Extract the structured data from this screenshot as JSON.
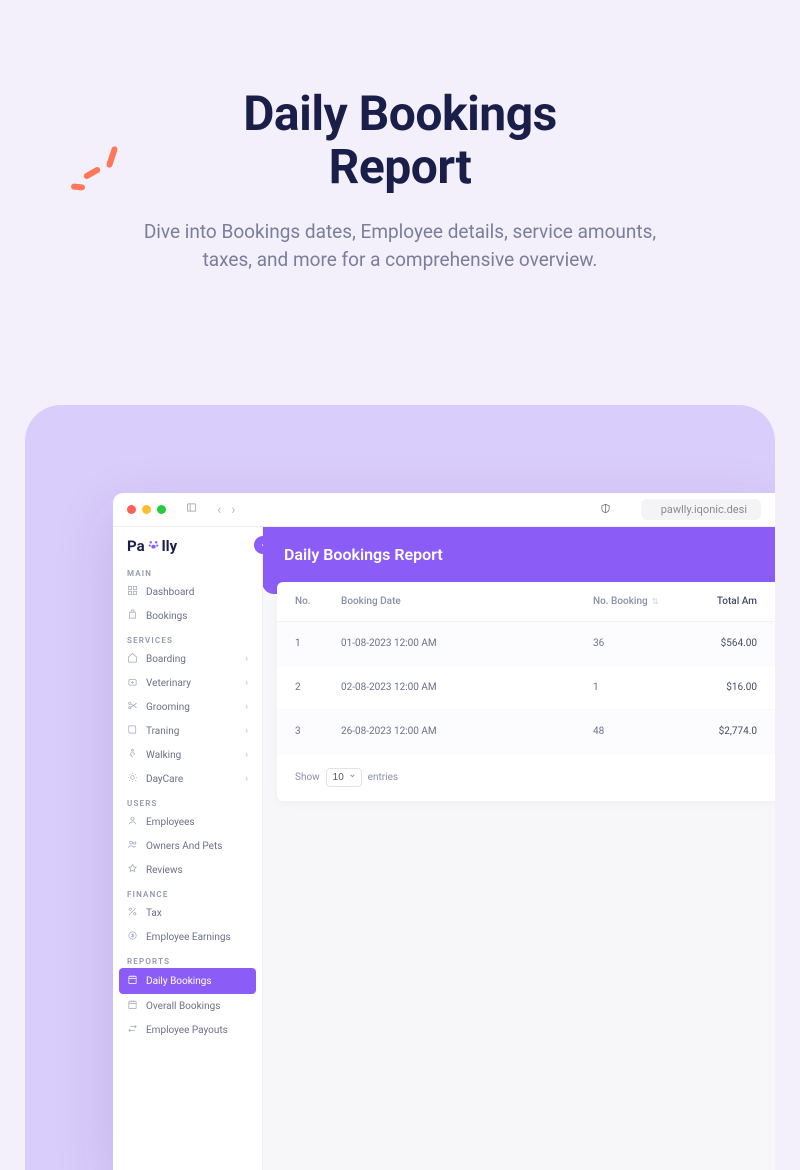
{
  "hero": {
    "title_line1": "Daily Bookings",
    "title_line2": "Report",
    "subtitle": "Dive into Bookings dates, Employee details, service amounts, taxes, and more for a comprehensive overview."
  },
  "browser": {
    "url": "pawlly.iqonic.desi"
  },
  "logo": {
    "pre": "Pa",
    "post": "lly"
  },
  "sidebar": {
    "groups": [
      {
        "label": "MAIN",
        "items": [
          {
            "icon": "grid",
            "label": "Dashboard",
            "hasChildren": false
          },
          {
            "icon": "bag",
            "label": "Bookings",
            "hasChildren": false
          }
        ]
      },
      {
        "label": "SERVICES",
        "items": [
          {
            "icon": "home",
            "label": "Boarding",
            "hasChildren": true
          },
          {
            "icon": "plus-med",
            "label": "Veterinary",
            "hasChildren": true
          },
          {
            "icon": "scissor",
            "label": "Grooming",
            "hasChildren": true
          },
          {
            "icon": "book",
            "label": "Traning",
            "hasChildren": true
          },
          {
            "icon": "walk",
            "label": "Walking",
            "hasChildren": true
          },
          {
            "icon": "sun",
            "label": "DayCare",
            "hasChildren": true
          }
        ]
      },
      {
        "label": "USERS",
        "items": [
          {
            "icon": "user",
            "label": "Employees",
            "hasChildren": false
          },
          {
            "icon": "users",
            "label": "Owners And Pets",
            "hasChildren": false
          },
          {
            "icon": "star",
            "label": "Reviews",
            "hasChildren": false
          }
        ]
      },
      {
        "label": "FINANCE",
        "items": [
          {
            "icon": "percent",
            "label": "Tax",
            "hasChildren": false
          },
          {
            "icon": "coin",
            "label": "Employee Earnings",
            "hasChildren": false
          }
        ]
      },
      {
        "label": "REPORTS",
        "items": [
          {
            "icon": "cal",
            "label": "Daily Bookings",
            "hasChildren": false,
            "active": true
          },
          {
            "icon": "cal",
            "label": "Overall Bookings",
            "hasChildren": false
          },
          {
            "icon": "switch",
            "label": "Employee Payouts",
            "hasChildren": false
          }
        ]
      }
    ]
  },
  "content": {
    "title": "Daily Bookings Report",
    "columns": {
      "no": "No.",
      "date": "Booking Date",
      "booking": "No. Booking",
      "amount": "Total Am"
    },
    "rows": [
      {
        "no": "1",
        "date": "01-08-2023 12:00 AM",
        "booking": "36",
        "amount": "$564.00"
      },
      {
        "no": "2",
        "date": "02-08-2023 12:00 AM",
        "booking": "1",
        "amount": "$16.00"
      },
      {
        "no": "3",
        "date": "26-08-2023 12:00 AM",
        "booking": "48",
        "amount": "$2,774.0"
      }
    ],
    "pager": {
      "show": "Show",
      "value": "10",
      "entries": "entries"
    }
  },
  "chart_data": {
    "type": "table",
    "title": "Daily Bookings Report",
    "columns": [
      "No.",
      "Booking Date",
      "No. Booking",
      "Total Amount"
    ],
    "rows": [
      [
        1,
        "01-08-2023 12:00 AM",
        36,
        564.0
      ],
      [
        2,
        "02-08-2023 12:00 AM",
        1,
        16.0
      ],
      [
        3,
        "26-08-2023 12:00 AM",
        48,
        2774.0
      ]
    ]
  }
}
